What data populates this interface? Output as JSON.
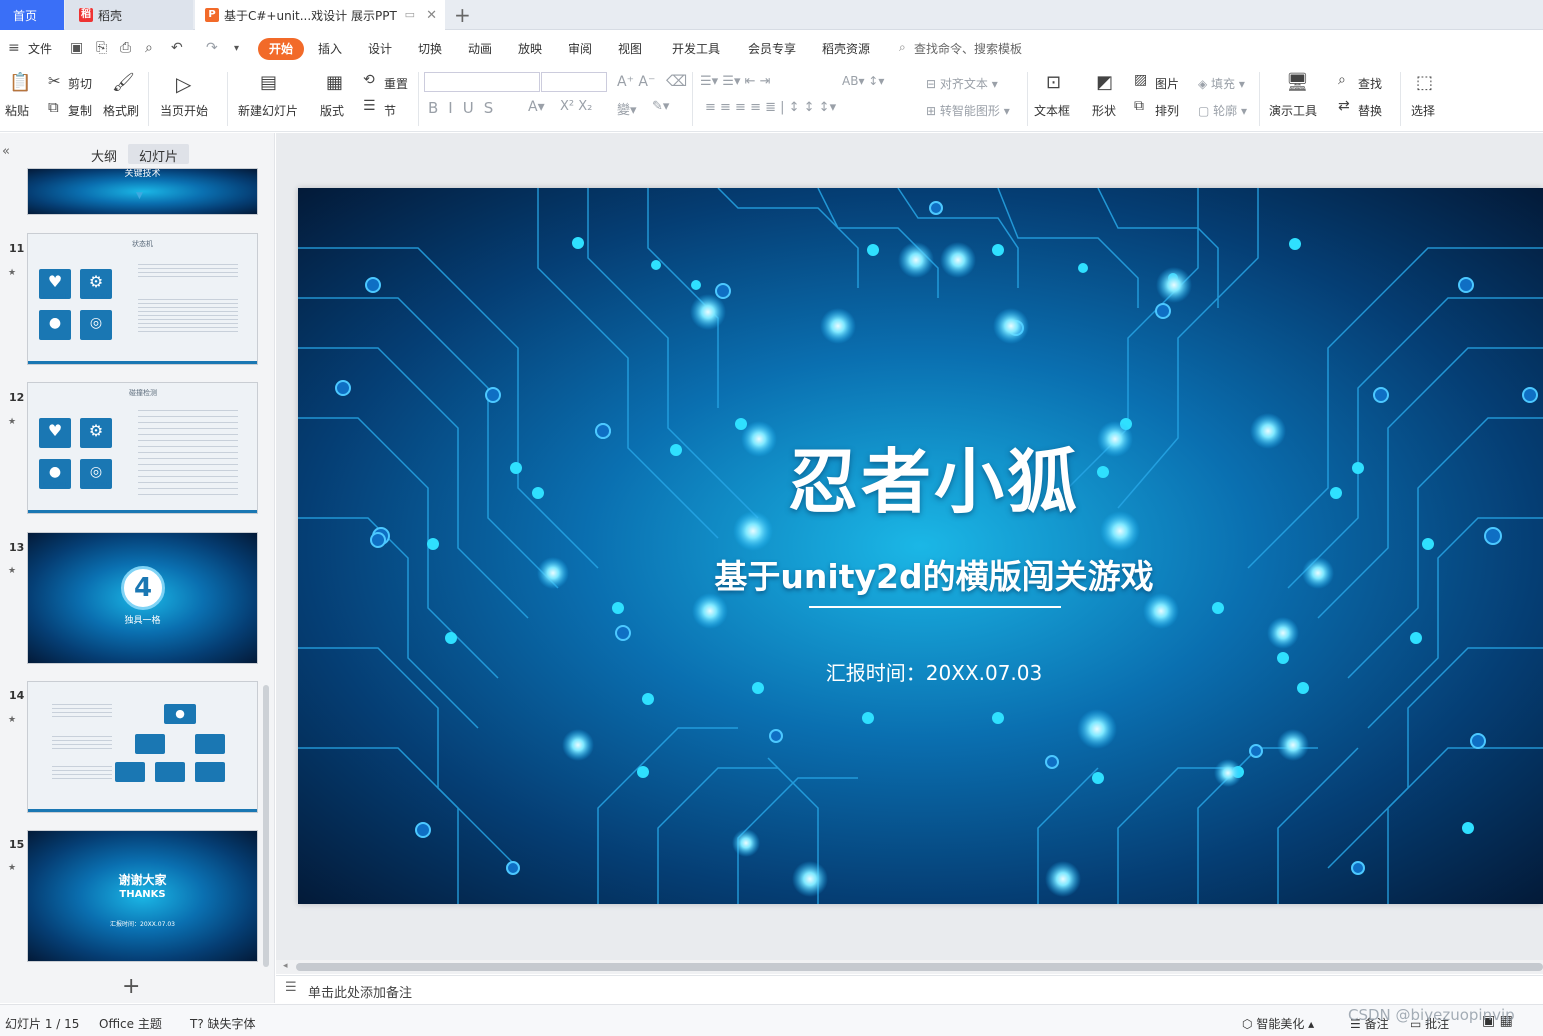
{
  "tabs": {
    "home": "首页",
    "docer": "稻壳",
    "document": "基于C#+unit...戏设计 展示PPT"
  },
  "menu": {
    "file": "文件",
    "items": [
      "开始",
      "插入",
      "设计",
      "切换",
      "动画",
      "放映",
      "审阅",
      "视图",
      "开发工具",
      "会员专享",
      "稻壳资源"
    ],
    "search_placeholder": "查找命令、搜索模板"
  },
  "ribbon": {
    "paste": "粘贴",
    "cut": "剪切",
    "copy": "复制",
    "format_painter": "格式刷",
    "play_from_current": "当页开始",
    "new_slide": "新建幻灯片",
    "layout": "版式",
    "reset": "重置",
    "section": "节",
    "align_text": "对齐文本",
    "to_smartart": "转智能图形",
    "textbox": "文本框",
    "shape": "形状",
    "picture": "图片",
    "arrange": "排列",
    "fill": "填充",
    "outline": "轮廓",
    "present_tools": "演示工具",
    "find": "查找",
    "replace": "替换",
    "select": "选择"
  },
  "panel": {
    "outline_tab": "大纲",
    "slides_tab": "幻灯片",
    "thumb_top_title": "关键技术",
    "thumbs": [
      {
        "num": "11",
        "title": "状态机",
        "keyword": "KEYWORD"
      },
      {
        "num": "12",
        "title": "碰撞检测",
        "keyword": "KEYWORD"
      },
      {
        "num": "13",
        "big_number": "4",
        "subtitle": "独具一格"
      },
      {
        "num": "14"
      },
      {
        "num": "15",
        "title": "谢谢大家",
        "subtitle": "THANKS",
        "date": "汇报时间：20XX.07.03"
      }
    ],
    "add_slide": "+"
  },
  "slide": {
    "title": "忍者小狐",
    "subtitle": "基于unity2d的横版闯关游戏",
    "date": "汇报时间：20XX.07.03"
  },
  "notes_placeholder": "单击此处添加备注",
  "status": {
    "slide_count": "幻灯片 1 / 15",
    "theme": "Office 主题",
    "missing_font": "缺失字体",
    "beautify": "智能美化",
    "notes": "备注",
    "comments": "批注",
    "watermark": "CSDN @biyezuopinvip"
  },
  "colors": {
    "accent": "#3a6ff7",
    "start_tab": "#f26a29",
    "slide_bg": "#0a6fb0",
    "thumb_box": "#1a77b3"
  }
}
